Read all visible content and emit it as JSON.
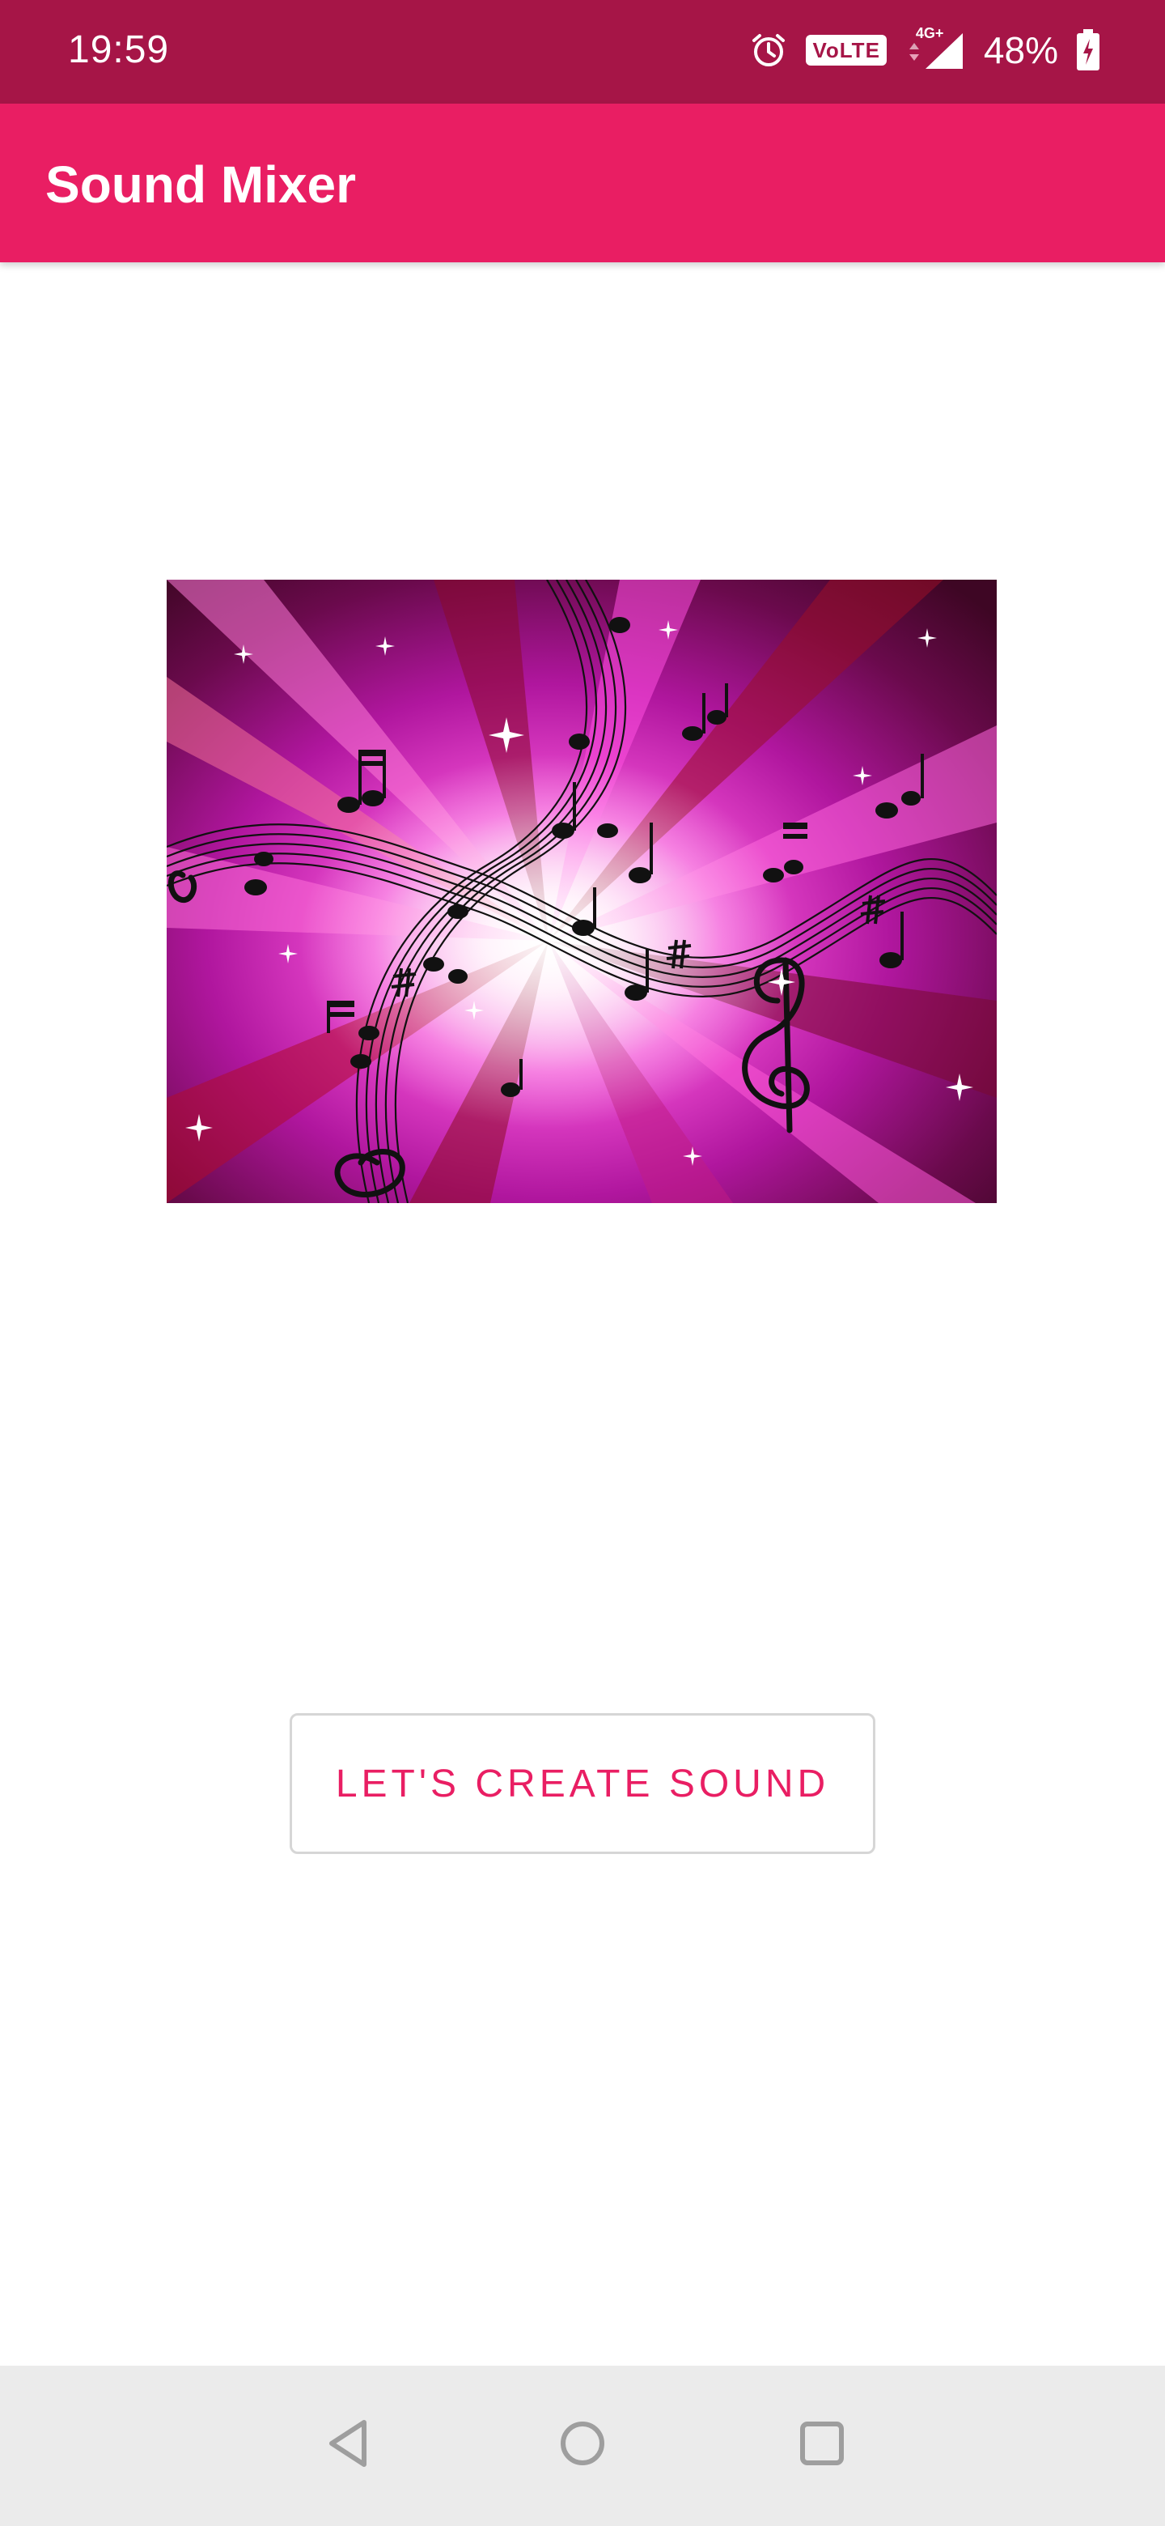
{
  "status_bar": {
    "time": "19:59",
    "volte": "VoLTE",
    "network_type": "4G+",
    "battery_percent": "48%",
    "icons": [
      "alarm-icon",
      "volte-icon",
      "signal-icon",
      "battery-charging-icon"
    ]
  },
  "app_bar": {
    "title": "Sound Mixer"
  },
  "hero": {
    "image": "music-notes-burst-image"
  },
  "actions": {
    "create_label": "LET'S CREATE SOUND"
  },
  "nav_bar": {
    "buttons": [
      "back-icon",
      "home-icon",
      "recents-icon"
    ]
  },
  "colors": {
    "status_bar": "#a61547",
    "app_bar": "#e91e63",
    "accent": "#e91e63",
    "nav_bar": "#ebebeb"
  }
}
